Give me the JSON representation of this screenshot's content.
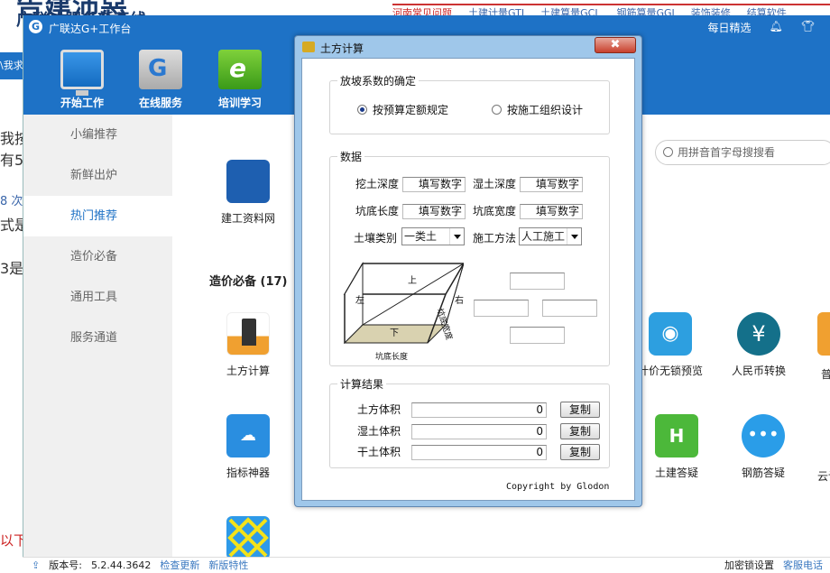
{
  "background": {
    "title_big": "告建沛惡",
    "title_sub": "广联达服务新干线",
    "top_nav": [
      "河南常见问题",
      "土建计量GTJ",
      "土建算量GCL",
      "钢筋算量GGJ",
      "装饰装修",
      "结算软件"
    ],
    "left_fragments": [
      "我按",
      "有5",
      "",
      "8 次",
      "式是",
      "",
      "3是",
      "",
      "",
      "",
      "",
      "",
      "",
      "",
      "",
      "",
      "",
      "",
      "以下"
    ],
    "side_tab_fragment": "\\我求"
  },
  "app": {
    "title": "广联达G+工作台",
    "daily": "每日精选",
    "toolbar": [
      {
        "label": "开始工作",
        "icon": "monitor-icon"
      },
      {
        "label": "在线服务",
        "icon": "online-service-icon"
      },
      {
        "label": "培训学习",
        "icon": "training-icon"
      }
    ],
    "sidebar": [
      "小编推荐",
      "新鲜出炉",
      "热门推荐",
      "造价必备",
      "通用工具",
      "服务通道"
    ],
    "search_placeholder": "用拼音首字母搜搜看",
    "section_title": "造价必备 (17)",
    "icons": {
      "construction": "建工资料网",
      "earthwork": "土方计算",
      "indicator": "指标神器",
      "price_preview": "计价无锁预览",
      "rmb": "人民币转换",
      "civil_qa": "土建答疑",
      "rebar_qa": "钢筋答疑",
      "cloud": "云计",
      "common": "普"
    },
    "status": {
      "version_label": "版本号:",
      "version": "5.2.44.3642",
      "check_update": "检查更新",
      "new_features": "新版特性",
      "lock_settings": "加密锁设置",
      "customer_service": "客服电话"
    }
  },
  "dialog": {
    "title": "土方计算",
    "close_label": "✖",
    "slope_group": "放坡系数的确定",
    "radio_budget": "按预算定额规定",
    "radio_construction": "按施工组织设计",
    "data_group": "数据",
    "dig_depth": "挖土深度",
    "wet_depth": "湿土深度",
    "pit_length": "坑底长度",
    "pit_width": "坑底宽度",
    "fill_number": "填写数字",
    "soil_type_label": "土壤类别",
    "soil_type_value": "一类土",
    "method_label": "施工方法",
    "method_value": "人工施工",
    "diagram": {
      "top": "上",
      "left": "左",
      "right": "右",
      "bottom": "下",
      "pit_width_vertical": "坑底宽度",
      "pit_length": "坑底长度"
    },
    "result_group": "计算结果",
    "earth_volume": "土方体积",
    "wet_volume": "湿土体积",
    "dry_volume": "干土体积",
    "zero": "0",
    "copy": "复制",
    "copyright": "Copyright by Glodon"
  }
}
